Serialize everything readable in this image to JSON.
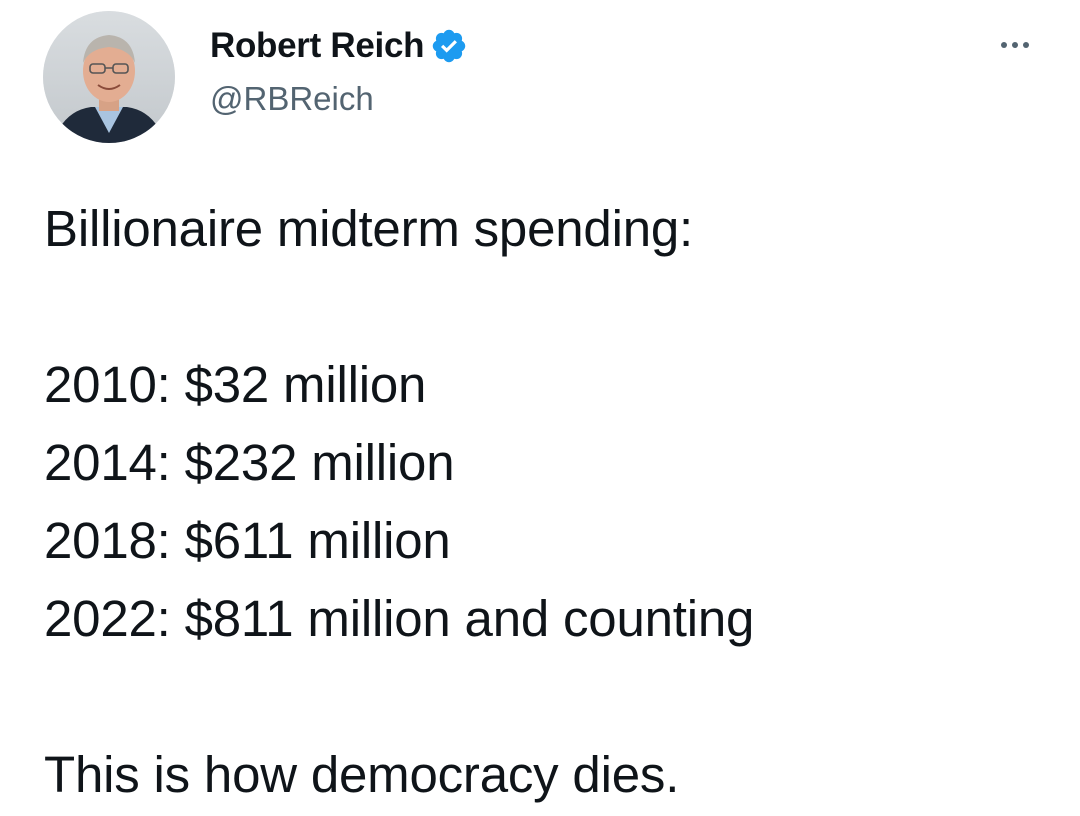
{
  "author": {
    "display_name": "Robert Reich",
    "handle": "@RBReich",
    "verified": true,
    "verified_color": "#1d9bf0"
  },
  "menu": {
    "more_icon": "more-horizontal-icon"
  },
  "tweet": {
    "heading": "Billionaire midterm spending:",
    "lines": [
      "2010: $32 million",
      "2014: $232 million",
      "2018: $611 million",
      "2022: $811 million and counting"
    ],
    "closing": "This is how democracy dies."
  }
}
